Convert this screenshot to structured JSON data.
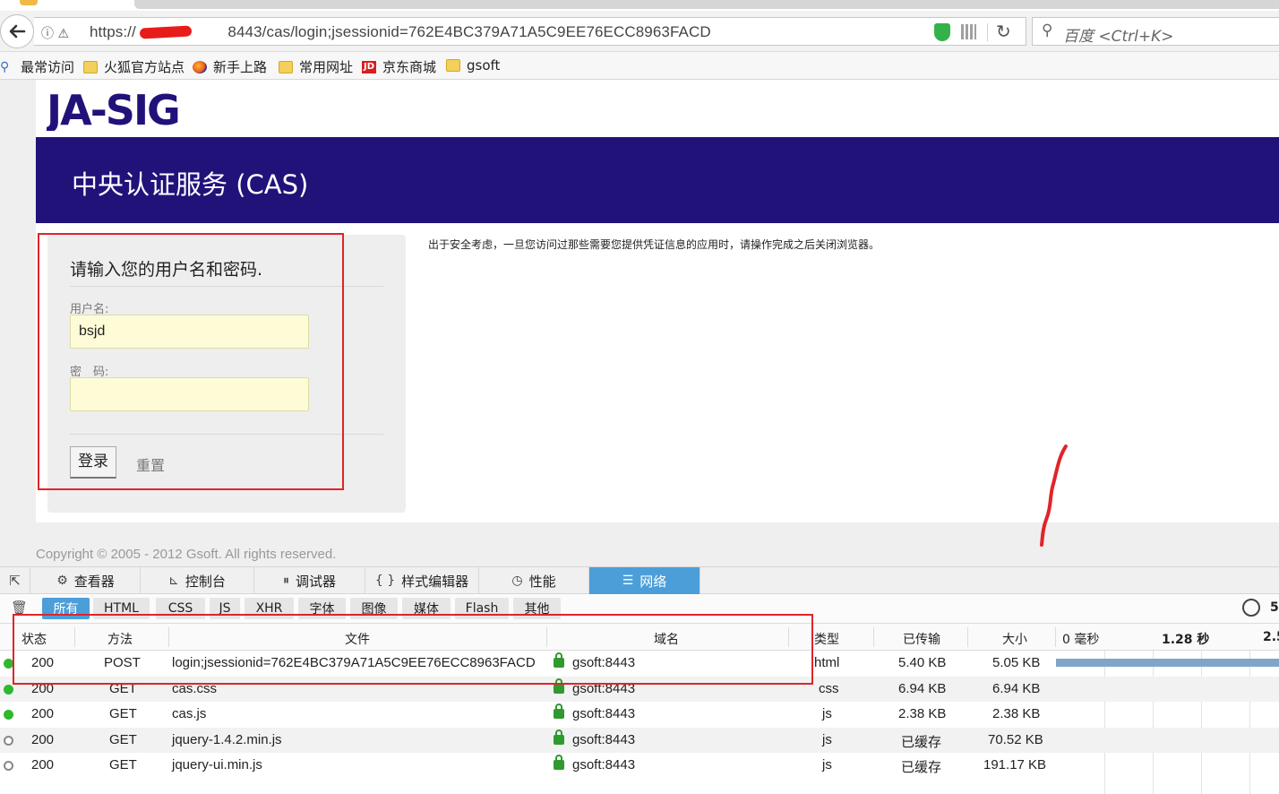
{
  "browser": {
    "url": "https://      8443/cas/login;jsessionid=762E4BC379A71A5C9EE76ECC8963FACD",
    "search_placeholder": "百度 <Ctrl+K>",
    "bookmarks": [
      "最常访问",
      "火狐官方站点",
      "新手上路",
      "常用网址",
      "京东商城",
      "gsoft"
    ]
  },
  "page": {
    "logo_text": "JA-SIG",
    "banner_title": "中央认证服务 (CAS)",
    "login": {
      "heading": "请输入您的用户名和密码.",
      "username_label": "用户名:",
      "username_value": "bsjd",
      "password_label": "密　码:",
      "password_value": "",
      "submit_label": "登录",
      "reset_label": "重置"
    },
    "notice": "出于安全考虑，一旦您访问过那些需要您提供凭证信息的应用时，请操作完成之后关闭浏览器。",
    "copyright": "Copyright © 2005 - 2012 Gsoft. All rights reserved."
  },
  "devtools": {
    "tabs": [
      "查看器",
      "控制台",
      "调试器",
      "样式编辑器",
      "性能",
      "网络"
    ],
    "active_tab": "网络",
    "filters": [
      "所有",
      "HTML",
      "CSS",
      "JS",
      "XHR",
      "字体",
      "图像",
      "媒体",
      "Flash",
      "其他"
    ],
    "active_filter": "所有",
    "timer_text": "5",
    "columns": [
      "状态",
      "方法",
      "文件",
      "域名",
      "类型",
      "已传输",
      "大小"
    ],
    "timeline_ticks": [
      "0 毫秒",
      "1.28 秒",
      "2.5"
    ],
    "rows": [
      {
        "status": "200",
        "method": "POST",
        "file": "login;jsessionid=762E4BC379A71A5C9EE76ECC8963FACD",
        "domain": "gsoft:8443",
        "type": "html",
        "transferred": "5.40 KB",
        "size": "5.05 KB"
      },
      {
        "status": "200",
        "method": "GET",
        "file": "cas.css",
        "domain": "gsoft:8443",
        "type": "css",
        "transferred": "6.94 KB",
        "size": "6.94 KB"
      },
      {
        "status": "200",
        "method": "GET",
        "file": "cas.js",
        "domain": "gsoft:8443",
        "type": "js",
        "transferred": "2.38 KB",
        "size": "2.38 KB"
      },
      {
        "status": "200",
        "method": "GET",
        "file": "jquery-1.4.2.min.js",
        "domain": "gsoft:8443",
        "type": "js",
        "transferred": "已缓存",
        "size": "70.52 KB"
      },
      {
        "status": "200",
        "method": "GET",
        "file": "jquery-ui.min.js",
        "domain": "gsoft:8443",
        "type": "js",
        "transferred": "已缓存",
        "size": "191.17 KB"
      }
    ]
  },
  "colors": {
    "banner": "#21127a",
    "annotation_red": "#e0242a",
    "devtools_active": "#4c9ed9"
  }
}
